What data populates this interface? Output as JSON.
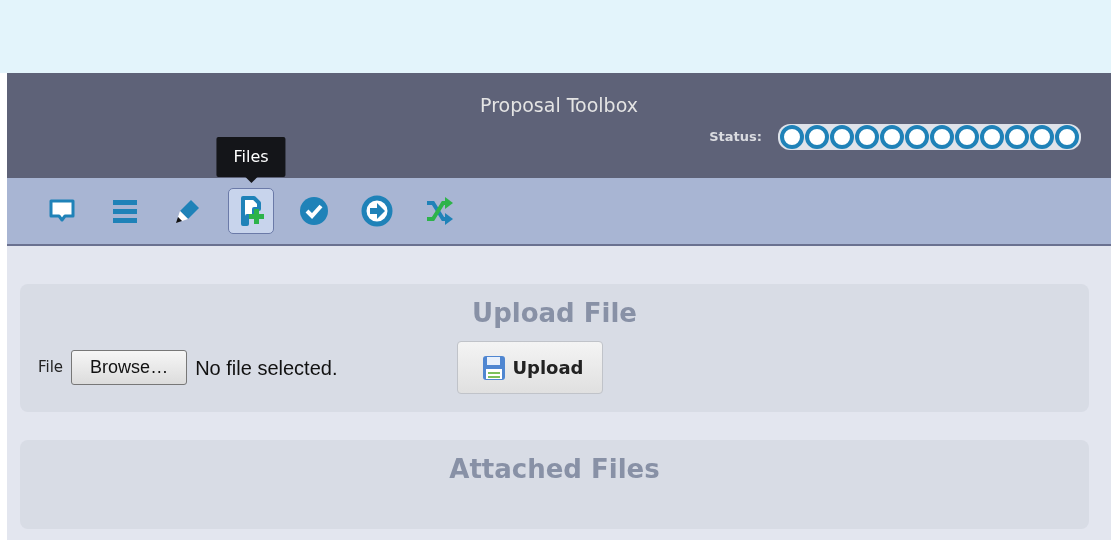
{
  "header": {
    "title": "Proposal Toolbox",
    "status_label": "Status:",
    "status_steps": [
      {
        "done": false
      },
      {
        "done": false
      },
      {
        "done": false
      },
      {
        "done": false
      },
      {
        "done": false
      },
      {
        "done": false
      },
      {
        "done": false
      },
      {
        "done": false
      },
      {
        "done": false
      },
      {
        "done": false
      },
      {
        "done": false
      },
      {
        "done": false
      }
    ]
  },
  "toolbar": [
    {
      "kind": "comment",
      "selected": false
    },
    {
      "kind": "list",
      "selected": false
    },
    {
      "kind": "pencil",
      "selected": false
    },
    {
      "kind": "file-add",
      "selected": true,
      "tooltip": "Files"
    },
    {
      "kind": "check",
      "selected": false
    },
    {
      "kind": "arrow",
      "selected": false
    },
    {
      "kind": "shuffle",
      "selected": false
    }
  ],
  "upload_panel": {
    "title": "Upload File",
    "file_label": "File",
    "browse_button": "Browse…",
    "file_status": "No file selected.",
    "upload_button": "Upload"
  },
  "attached_panel": {
    "title": "Attached Files"
  }
}
